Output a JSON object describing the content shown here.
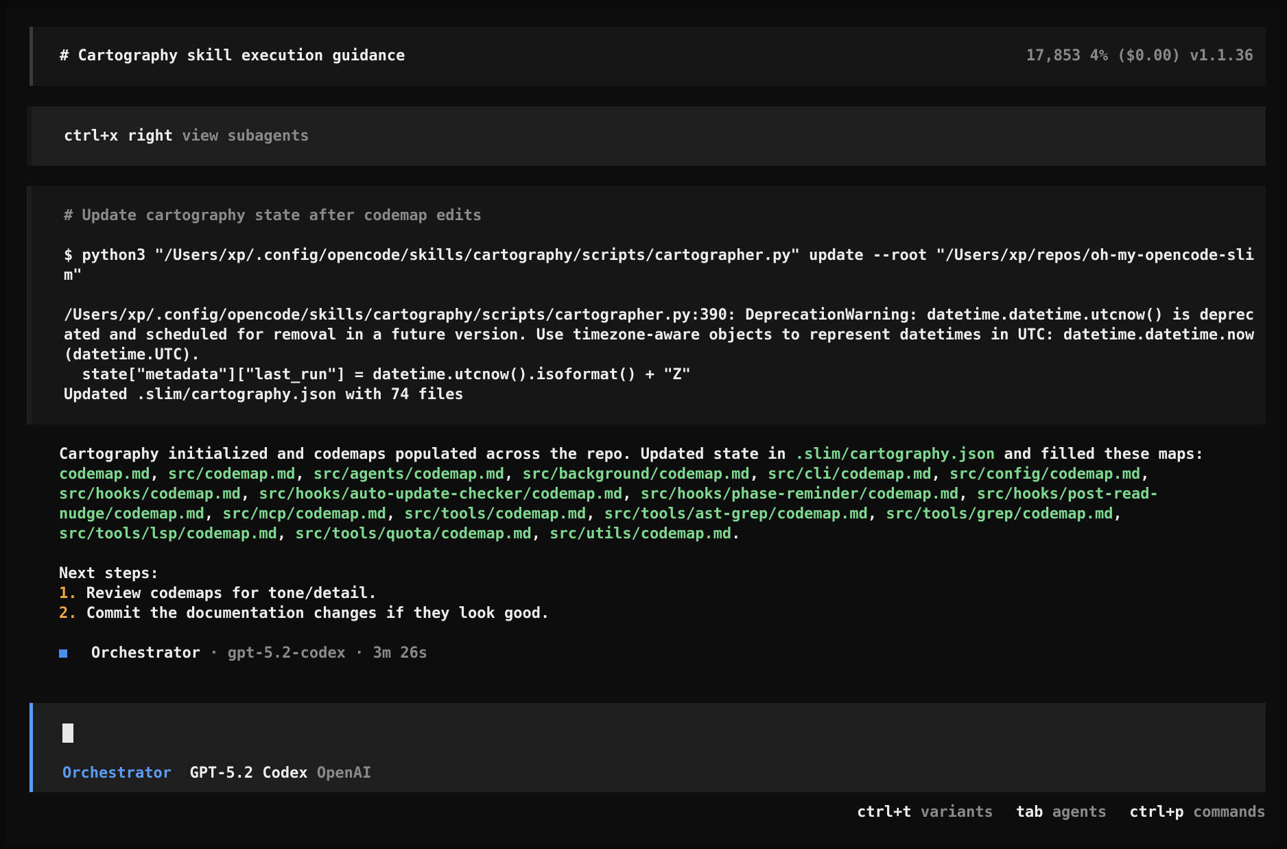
{
  "header": {
    "title": "# Cartography skill execution guidance",
    "stats": "17,853  4% ($0.00) v1.1.36"
  },
  "hint": {
    "key": "ctrl+x right",
    "label": "view subagents"
  },
  "bash": {
    "comment": "# Update cartography state after codemap edits",
    "command": "$ python3 \"/Users/xp/.config/opencode/skills/cartography/scripts/cartographer.py\" update --root \"/Users/xp/repos/oh-my-opencode-slim\"",
    "output": "/Users/xp/.config/opencode/skills/cartography/scripts/cartographer.py:390: DeprecationWarning: datetime.datetime.utcnow() is deprecated and scheduled for removal in a future version. Use timezone-aware objects to represent datetimes in UTC: datetime.datetime.now(datetime.UTC).\n  state[\"metadata\"][\"last_run\"] = datetime.utcnow().isoformat() + \"Z\"\nUpdated .slim/cartography.json with 74 files"
  },
  "message": {
    "intro": "Cartography initialized and codemaps populated across the repo. Updated state in ",
    "state_file": ".slim/cartography.json",
    "and_text": " and filled these maps: ",
    "maps": [
      "codemap.md",
      "src/codemap.md",
      "src/agents/codemap.md",
      "src/background/codemap.md",
      "src/cli/codemap.md",
      "src/config/codemap.md",
      "src/hooks/codemap.md",
      "src/hooks/auto-update-checker/codemap.md",
      "src/hooks/phase-reminder/codemap.md",
      "src/hooks/post-read-nudge/codemap.md",
      "src/mcp/codemap.md",
      "src/tools/codemap.md",
      "src/tools/ast-grep/codemap.md",
      "src/tools/grep/codemap.md",
      "src/tools/lsp/codemap.md",
      "src/tools/quota/codemap.md",
      "src/utils/codemap.md"
    ],
    "sep": ", ",
    "end": ".",
    "next_steps_title": "Next steps:",
    "steps": [
      {
        "num": "1.",
        "text": "Review codemaps for tone/detail."
      },
      {
        "num": "2.",
        "text": "Commit the documentation changes if they look good."
      }
    ],
    "agent": "Orchestrator",
    "agent_meta": " · gpt-5.2-codex · 3m 26s"
  },
  "input": {
    "agent": "Orchestrator",
    "model": "GPT-5.2 Codex",
    "provider": "OpenAI"
  },
  "footer": [
    {
      "key": "ctrl+t",
      "label": "variants"
    },
    {
      "key": "tab",
      "label": "agents"
    },
    {
      "key": "ctrl+p",
      "label": "commands"
    }
  ],
  "colors": {
    "accent_blue": "#5c9cf5",
    "path_green": "#7fd88f",
    "number_orange": "#f5a742"
  }
}
